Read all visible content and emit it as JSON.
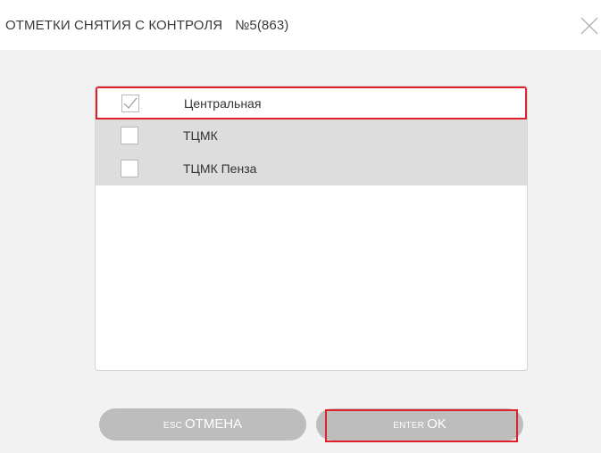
{
  "dialog": {
    "title": "ОТМЕТКИ СНЯТИЯ С КОНТРОЛЯ",
    "number": "№5(863)",
    "close_icon": "close-icon"
  },
  "list": {
    "items": [
      {
        "label": "Центральная",
        "checked": true,
        "selected": true
      },
      {
        "label": "ТЦМК",
        "checked": false,
        "selected": false
      },
      {
        "label": "ТЦМК Пенза",
        "checked": false,
        "selected": false
      }
    ]
  },
  "buttons": {
    "cancel": {
      "key": "ESC",
      "label": "ОТМЕНА"
    },
    "ok": {
      "key": "ENTER",
      "label": "OK"
    }
  },
  "colors": {
    "highlight": "#e0202a",
    "button": "#bdbdbd",
    "row": "#dddddd",
    "panel": "#f2f2f2"
  }
}
